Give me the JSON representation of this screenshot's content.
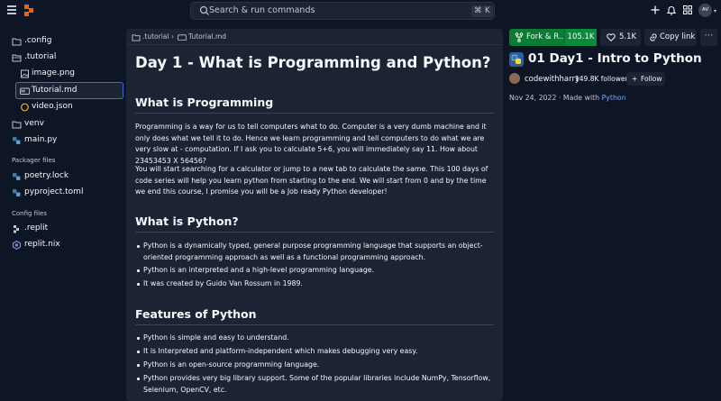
{
  "topbar": {
    "search_placeholder": "Search & run commands",
    "shortcut_mod": "⌘",
    "shortcut_key": "K",
    "avatar_initials": "AV",
    "avatar_chevron": "▾"
  },
  "files": {
    "items": [
      {
        "name": ".config",
        "icon": "folder-icon"
      },
      {
        "name": ".tutorial",
        "icon": "folder-icon"
      },
      {
        "name": "image.png",
        "icon": "image-file-icon"
      },
      {
        "name": "Tutorial.md",
        "icon": "markdown-file-icon"
      },
      {
        "name": "video.json",
        "icon": "json-file-icon"
      },
      {
        "name": "venv",
        "icon": "folder-icon"
      },
      {
        "name": "main.py",
        "icon": "python-file-icon"
      }
    ],
    "packager_label": "Packager files",
    "packager": [
      {
        "name": "poetry.lock",
        "icon": "python-file-icon"
      },
      {
        "name": "pyproject.toml",
        "icon": "python-file-icon"
      }
    ],
    "config_label": "Config files",
    "config": [
      {
        "name": ".replit",
        "icon": "replit-config-icon"
      },
      {
        "name": "replit.nix",
        "icon": "nix-icon"
      }
    ]
  },
  "editor": {
    "breadcrumb_folder": ".tutorial",
    "breadcrumb_sep": "›",
    "breadcrumb_file": "Tutorial.md",
    "h1": "Day 1 - What is Programming and Python?",
    "h2_programming": "What is Programming",
    "p1": "Programming is a way for us to tell computers what to do. Computer is a very dumb machine and it only does what we tell it to do. Hence we learn programming and tell computers to do what we are very slow at - computation. If I ask you to calculate 5+6, you will immediately say 11. How about 23453453 X 56456?",
    "p2": "You will start searching for a calculator or jump to a new tab to calculate the same. This 100 days of code series will help you learn python from starting to the end. We will start from 0 and by the time we end this course, I promise you will be a Job ready Python developer!",
    "h2_python": "What is Python?",
    "python_bullets": [
      "Python is a dynamically typed, general purpose programming language that supports an object-oriented programming approach as well as a functional programming approach.",
      "Python is an interpreted and a high-level programming language.",
      "It was created by Guido Van Rossum in 1989."
    ],
    "h2_features": "Features of Python",
    "feature_bullets": [
      "Python is simple and easy to understand.",
      "It is Interpreted and platform-independent which makes debugging very easy.",
      "Python is an open-source programming language.",
      "Python provides very big library support. Some of the popular libraries include NumPy, Tensorflow, Selenium, OpenCV, etc."
    ]
  },
  "repl": {
    "fork_label": "Fork & R...",
    "fork_count": "105.1K",
    "like_count": "5.1K",
    "copy_label": "Copy link",
    "more_label": "⋯",
    "title": "01 Day1 - Intro to Python",
    "author": "codewithharry",
    "followers": "149.8K followers",
    "follow_label": "Follow",
    "follow_plus": "+",
    "date": "Nov 24, 2022 · Made with ",
    "language": "Python"
  },
  "colors": {
    "background": "#0e1525",
    "panel": "#1c2333",
    "accent_orange": "#f26207",
    "fork_green": "#0a7c33",
    "selection_blue": "#3c6dd8",
    "link_blue": "#7aa9ff"
  }
}
